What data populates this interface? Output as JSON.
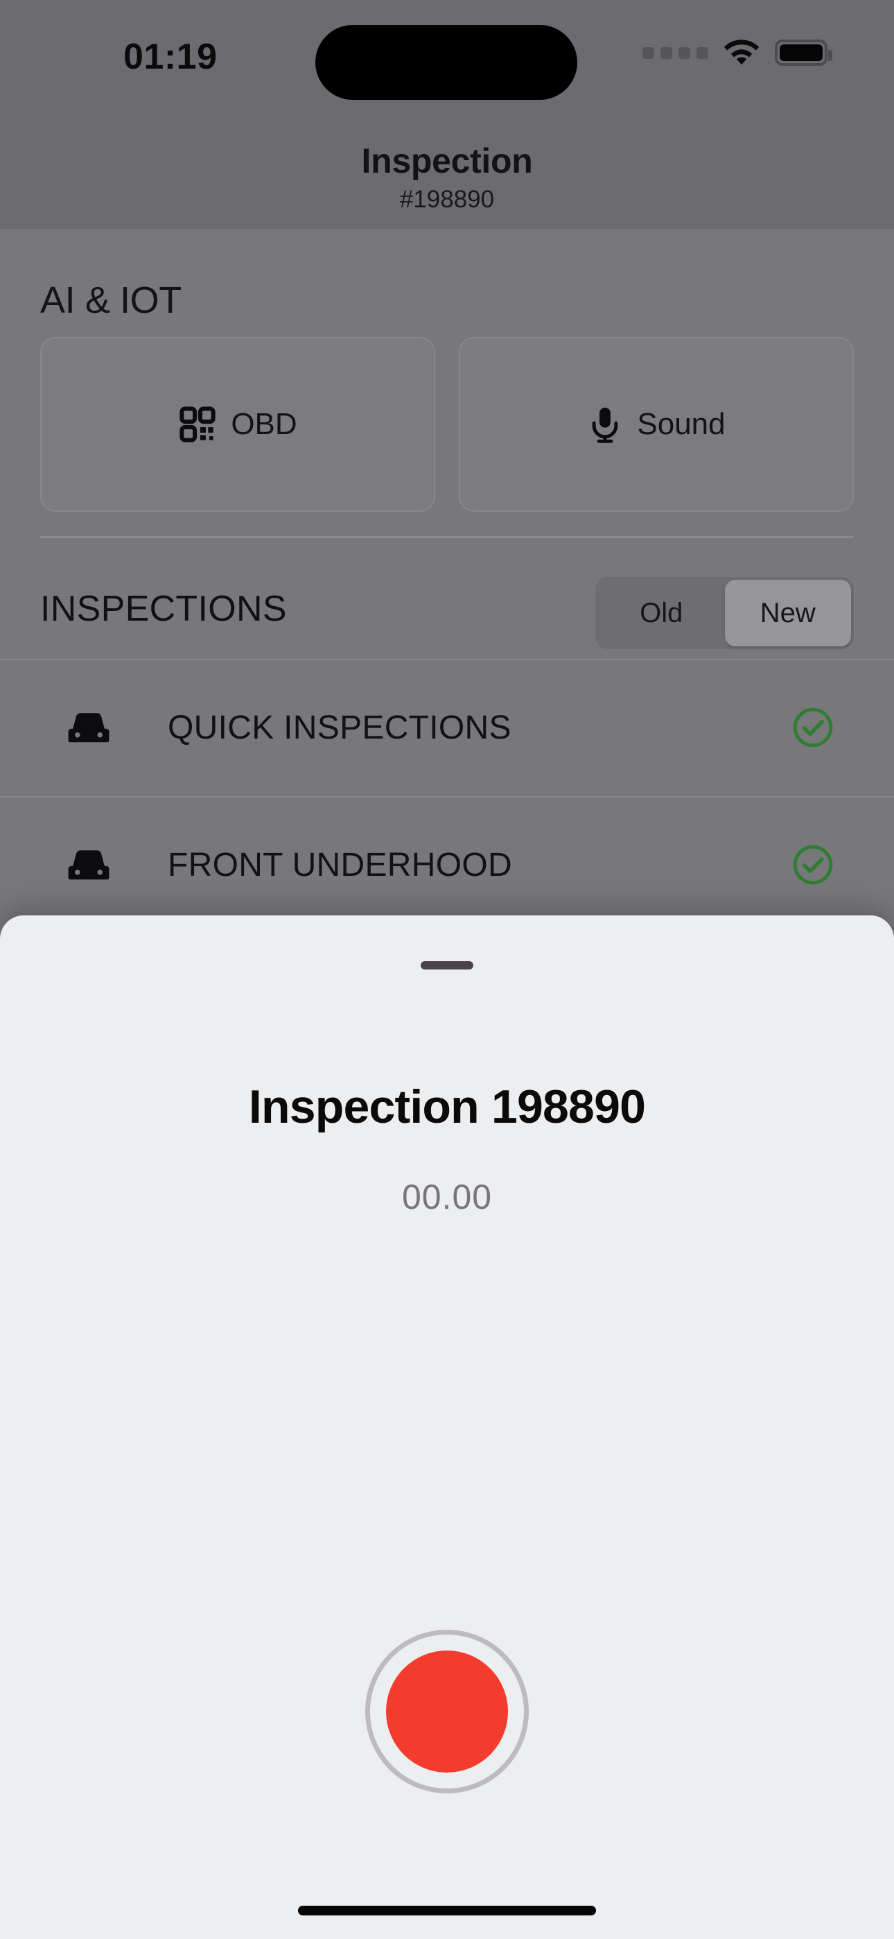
{
  "status_bar": {
    "time": "01:19",
    "signal_icon": "signal-dots-icon",
    "wifi_icon": "wifi-icon",
    "battery_icon": "battery-full-icon"
  },
  "nav_header": {
    "title": "Inspection",
    "subtitle": "#198890"
  },
  "ai_iot": {
    "section_title": "AI & IOT",
    "tools": [
      {
        "label": "OBD",
        "icon": "qr-code-icon"
      },
      {
        "label": "Sound",
        "icon": "microphone-icon"
      }
    ]
  },
  "inspections": {
    "section_title": "INSPECTIONS",
    "segmented": {
      "options": [
        "Old",
        "New"
      ],
      "selected": "New"
    },
    "rows": [
      {
        "label": "QUICK INSPECTIONS",
        "icon": "car-icon",
        "status_icon": "check-circle-icon",
        "status_color": "#2e7d32"
      },
      {
        "label": "FRONT UNDERHOOD",
        "icon": "car-icon",
        "status_icon": "check-circle-icon",
        "status_color": "#2e7d32"
      }
    ]
  },
  "sheet": {
    "grabber": "drag-handle",
    "title": "Inspection 198890",
    "timer": "00.00",
    "record_button": {
      "icon": "record-icon",
      "color": "#f43c2e",
      "ring_color": "#bcbcbe"
    }
  },
  "home_indicator": "home-indicator"
}
